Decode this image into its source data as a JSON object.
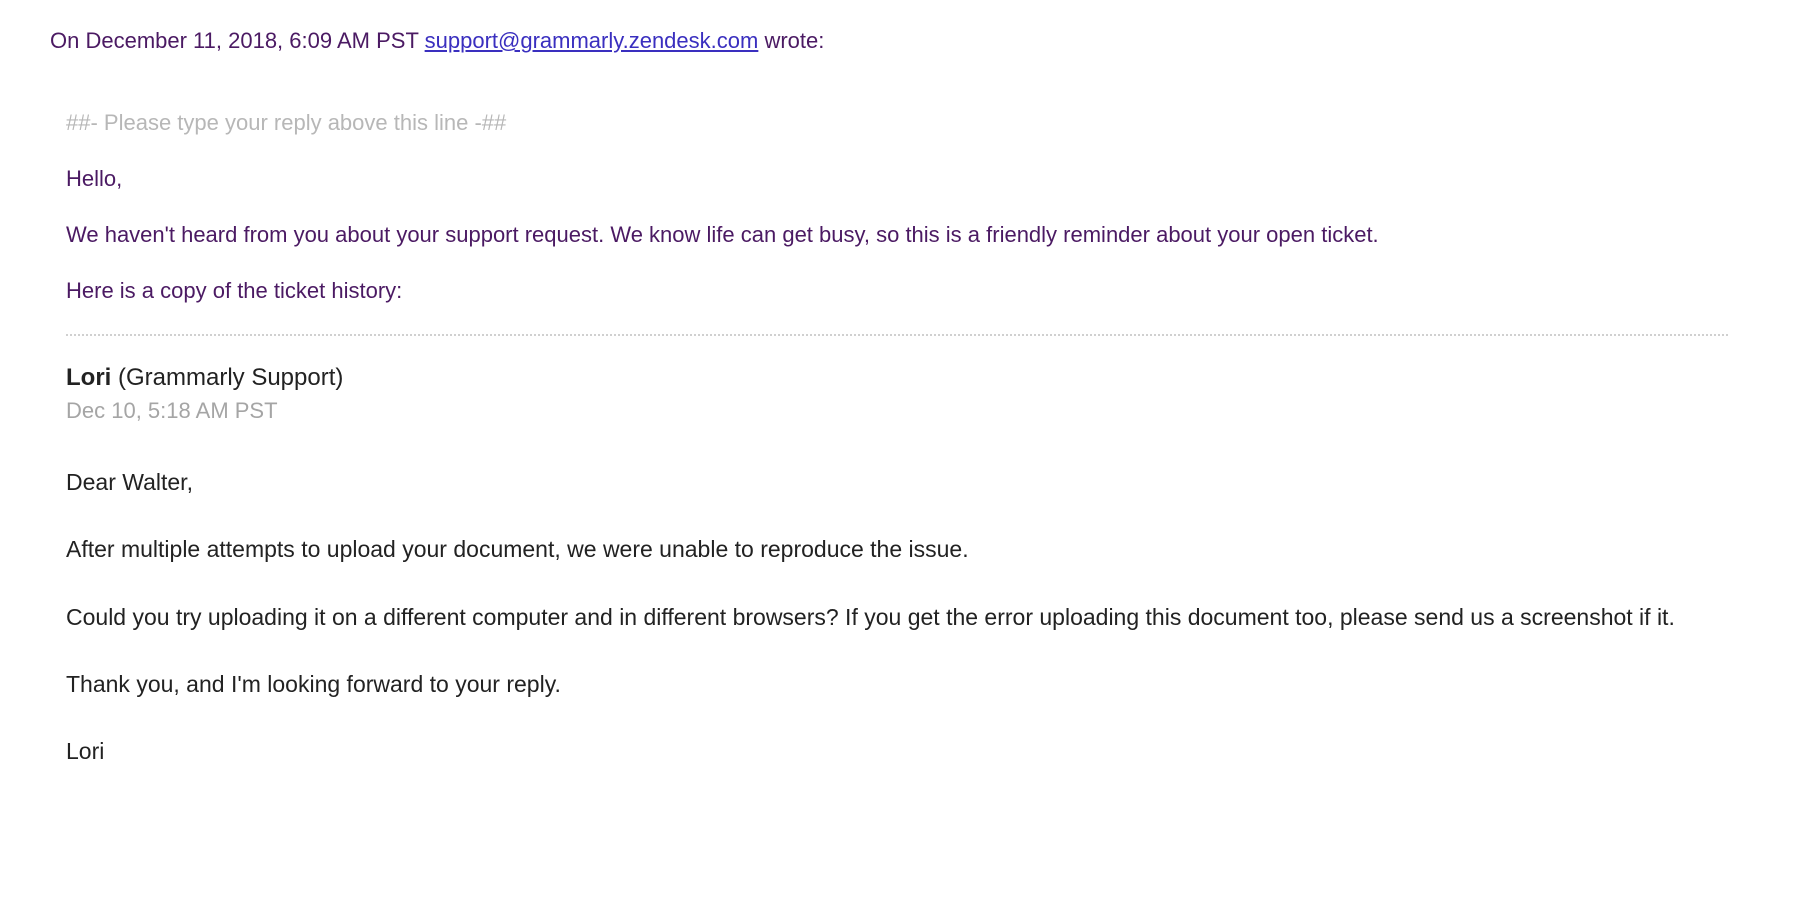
{
  "header": {
    "prefix": "On December 11, 2018, 6:09 AM PST ",
    "email": "support@grammarly.zendesk.com",
    "suffix": " wrote:"
  },
  "reply_marker": "##- Please type your reply above this line -##",
  "intro": {
    "greeting": "Hello,",
    "line1": "We haven't heard from you about your support request. We know life can get busy, so this is a friendly reminder about your open ticket.",
    "line2": "Here is a copy of the ticket history:"
  },
  "ticket": {
    "agent_name": "Lori",
    "agent_org": " (Grammarly Support)",
    "agent_time": "Dec 10, 5:18 AM PST",
    "body": {
      "p1": "Dear Walter,",
      "p2": "After multiple attempts to upload your document, we were unable to reproduce the issue.",
      "p3": "Could you try uploading it on a different computer and in different browsers? If you get the error uploading this document too, please send us a screenshot if it.",
      "p4": "Thank you, and I'm looking forward to your reply.",
      "p5": "Lori"
    }
  }
}
